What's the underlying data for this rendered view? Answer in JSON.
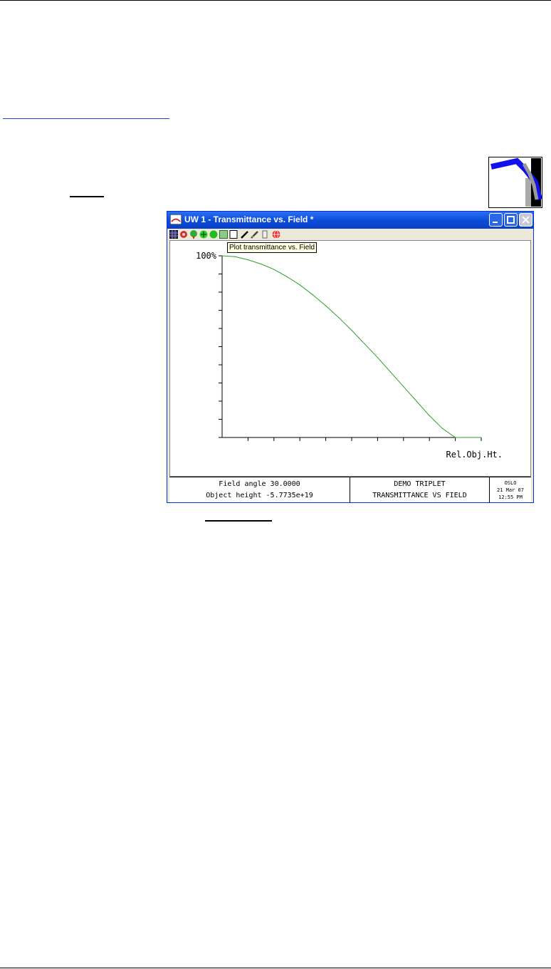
{
  "window": {
    "title": "UW 1 - Transmittance vs. Field *",
    "controls": {
      "minimize": "minimize",
      "maximize": "maximize",
      "close": "close"
    }
  },
  "toolbar": {
    "icons": [
      "grid-icon",
      "spot-icon",
      "tree-icon",
      "plus-icon",
      "circle-icon",
      "image-icon",
      "page-icon",
      "pen-icon",
      "pen2-icon",
      "marker-icon",
      "globe-icon"
    ],
    "tooltip": "Plot transmittance vs. Field"
  },
  "chart_data": {
    "type": "line",
    "title": "",
    "xlabel": "Rel.Obj.Ht.",
    "ylabel": "",
    "y_top_label": "100%",
    "xlim": [
      0,
      1
    ],
    "ylim": [
      0,
      100
    ],
    "grid": false,
    "series": [
      {
        "color": "#2ca02c",
        "x": [
          0.0,
          0.05,
          0.1,
          0.15,
          0.2,
          0.25,
          0.3,
          0.35,
          0.4,
          0.45,
          0.5,
          0.55,
          0.6,
          0.65,
          0.7,
          0.75,
          0.8,
          0.85,
          0.9,
          0.93,
          1.0
        ],
        "y": [
          100,
          99.5,
          97.8,
          95.5,
          92.5,
          88.5,
          84.0,
          78.5,
          72.5,
          66.0,
          59.0,
          51.5,
          44.0,
          36.0,
          28.0,
          20.0,
          12.0,
          5.0,
          0.0,
          0.0,
          0.0
        ]
      }
    ]
  },
  "footer": {
    "left": [
      "Field angle 30.0000",
      "Object height -5.7735e+19"
    ],
    "center": [
      "DEMO TRIPLET",
      "TRANSMITTANCE VS FIELD"
    ],
    "right": [
      "OSLO",
      "21 Mar 07",
      "12:55 PM"
    ]
  },
  "colors": {
    "titlebar": "#0a4bd8",
    "curve": "#2ca02c",
    "link": "#2244cc"
  }
}
